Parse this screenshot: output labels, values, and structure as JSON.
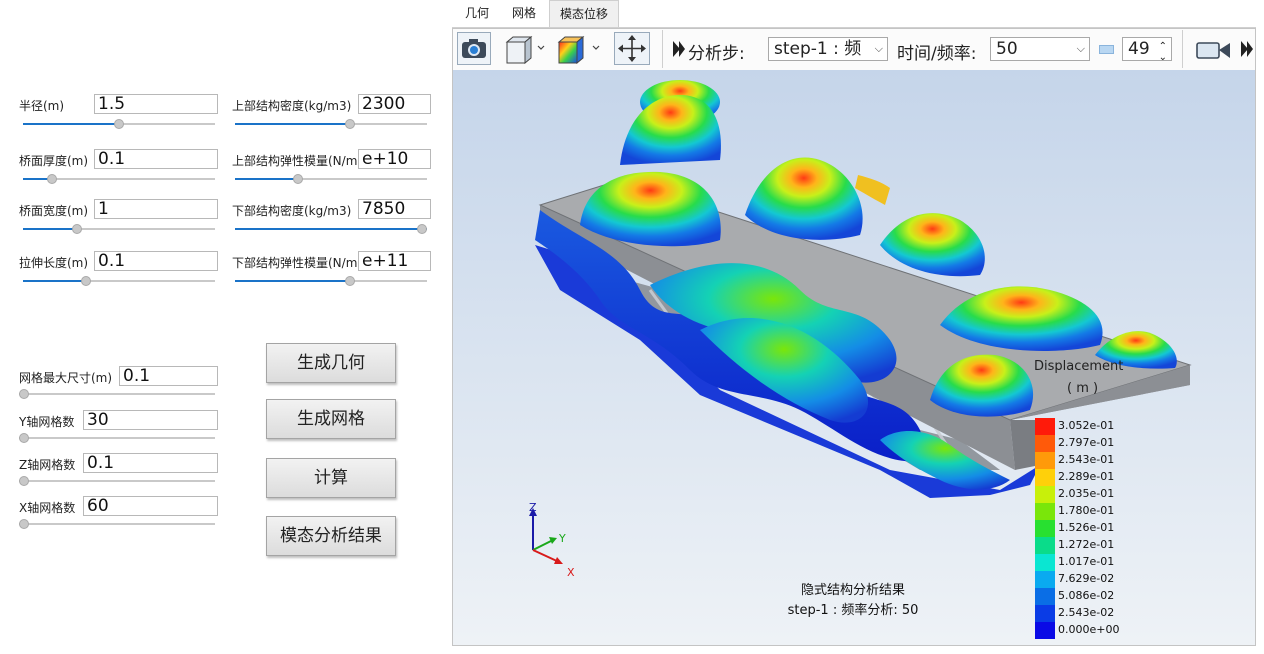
{
  "params_left": [
    {
      "label": "半径(m)",
      "value": "1.5",
      "slider": 0.5
    },
    {
      "label": "桥面厚度(m)",
      "value": "0.1",
      "slider": 0.15
    },
    {
      "label": "桥面宽度(m)",
      "value": "1",
      "slider": 0.28
    },
    {
      "label": "拉伸长度(m)",
      "value": "0.1",
      "slider": 0.33
    }
  ],
  "params_right": [
    {
      "label": "上部结构密度(kg/m3)",
      "value": "2300",
      "slider": 0.6
    },
    {
      "label": "上部结构弹性模量(N/m2)",
      "value": "e+10",
      "slider": 0.33
    },
    {
      "label": "下部结构密度(kg/m3)",
      "value": "7850",
      "slider": 1.0
    },
    {
      "label": "下部结构弹性模量(N/m2)",
      "value": "e+11",
      "slider": 0.6
    }
  ],
  "mesh_params": [
    {
      "label": "网格最大尺寸(m)",
      "value": "0.1",
      "slider": 0.0
    },
    {
      "label": "Y轴网格数",
      "value": "30",
      "slider": 0.0
    },
    {
      "label": "Z轴网格数",
      "value": "0.1",
      "slider": 0.0
    },
    {
      "label": "X轴网格数",
      "value": "60",
      "slider": 0.0
    }
  ],
  "buttons": {
    "gen_geometry": "生成几何",
    "gen_mesh": "生成网格",
    "compute": "计算",
    "modal_result": "模态分析结果"
  },
  "tabs": [
    "几何",
    "网格",
    "模态位移"
  ],
  "active_tab": 2,
  "toolbar": {
    "step_label": "分析步:",
    "step_value": "step-1 : 频",
    "time_label": "时间/频率:",
    "time_value": "50",
    "spin_value": "49"
  },
  "legend": {
    "title_line1": "Displacement",
    "title_line2": "( m )",
    "values": [
      "3.052e-01",
      "2.797e-01",
      "2.543e-01",
      "2.289e-01",
      "2.035e-01",
      "1.780e-01",
      "1.526e-01",
      "1.272e-01",
      "1.017e-01",
      "7.629e-02",
      "5.086e-02",
      "2.543e-02",
      "0.000e+00"
    ],
    "colors": [
      "#ff1a0a",
      "#ff5a0a",
      "#ff9a0a",
      "#ffd00a",
      "#c8f00a",
      "#7ae60a",
      "#28e030",
      "#0adc8a",
      "#0ae6d2",
      "#0aaaf0",
      "#0a6ee6",
      "#0a3ce6",
      "#0a0ae6"
    ]
  },
  "caption": {
    "line1": "隐式结构分析结果",
    "line2": "step-1 : 频率分析: 50"
  },
  "axes": {
    "z": "Z",
    "y": "Y",
    "x": "X"
  }
}
